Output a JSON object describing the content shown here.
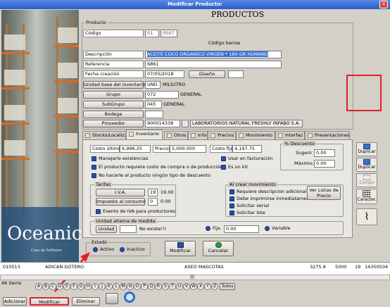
{
  "window": {
    "title": "Modificar Producto:",
    "heading": "PRODUCTOS",
    "close": "✕"
  },
  "product_group_label": "Producto",
  "fields": {
    "codigo_label": "Código",
    "codigo_prefix": "01",
    "codigo_value": "0507",
    "codigo_barras_label": "Código barras",
    "descripcion_label": "Descripción",
    "descripcion_value": "ACEITE COCO ORGANICO VIRGEN * 180 GR HUMANO",
    "referencia_label": "Referencia",
    "referencia_value": "6861",
    "fecha_label": "Fecha creación",
    "fecha_value": "07/05/2018",
    "diseno_button": "Diseño",
    "unidad_button": "Unidad base del inventario",
    "unidad_code": "UND",
    "unidad_name": "MILILITRO",
    "grupo_button": "Grupo",
    "grupo_code": "072",
    "grupo_name": "GENERAL",
    "subgrupo_button": "SubGrupo",
    "subgrupo_code": "045",
    "subgrupo_name": "GENERAL",
    "bodega_button": "Bodega",
    "proveedor_button": "Proveedor",
    "proveedor_code": "900014338",
    "proveedor_name": "LABORATORIOS NATURAL FRESHLY INFABO S.A."
  },
  "tabs": [
    {
      "label": "Stocks/Localiz."
    },
    {
      "label": "Inventario"
    },
    {
      "label": "Otros"
    },
    {
      "label": "Info"
    },
    {
      "label": "Precios"
    },
    {
      "label": "Movimiento"
    },
    {
      "label": "Interfaz"
    },
    {
      "label": "Presentaciones"
    }
  ],
  "inventario": {
    "costo_ultimo_label": "Costo último",
    "costo_ultimo_value": "6,996.25",
    "precio_label": "Precio",
    "precio_value": "5,000.000",
    "costo_fijo_label": "Costo fijo",
    "costo_fijo_value": "4,197.75",
    "descuento_title": "% Descuento",
    "sugerir_label": "Sugerir",
    "sugerir_value": "0.00",
    "maximo_label": "Máximo:",
    "maximo_value": "0.00",
    "manejarle_existencias": "Manejarle existencias",
    "usar_facturacion": "Usar en facturación",
    "requiere_costo": "El producto requiere costo de compra o de producción",
    "es_kit": "Es un kit",
    "no_hacerle_descuento": "No hacerle al producto ningún tipo de descuento",
    "tarifas_title": "Tarifas",
    "iva_button": "I.V.A.",
    "iva_code": "19",
    "iva_value": "19.00",
    "impuesto_button": "Impuesto al consumo",
    "impuesto_code": "0",
    "impuesto_value": "0.00",
    "exento_iva": "Exento de IVA para productores",
    "crear_mov_title": "Al crear movimiento",
    "requiere_descripcion": "Requiere descripcion adicional",
    "debe_imprimirse": "Debe imprimirse inmediatamente",
    "solicitar_serial": "Solicitar serial",
    "solicitar_lote": "Solicitar lote",
    "ver_listas_button": "Ver Listas de Precio",
    "unidad_alterna_title": "Unidad alterna de medida",
    "unidad_button": "Unidad",
    "no_existe": "No existe!!!",
    "fija_label": "Fija",
    "fija_value": "0.00",
    "variable_label": "Variable"
  },
  "side_buttons": {
    "duplicar1": "Duplicar",
    "duplicar2": "Duplicar",
    "compo": "Compo",
    "caracter": "Caracter."
  },
  "estado": {
    "title": "Estado",
    "activo": "Activo",
    "inactivo": "Inactivo"
  },
  "actions": {
    "modificar": "Modificar",
    "cancelar": "Cancelar"
  },
  "logo": {
    "name": "Oceanic",
    "tagline": "Casa de Software"
  },
  "list_row": {
    "code": "010513",
    "name": "ADICAN GOTERO",
    "category": "ASEO MASCOTAS",
    "v1": "3275.9",
    "v2": "5000",
    "v3": "19",
    "v4": "14350504"
  },
  "items_count": "46 items",
  "scroll_glyph": "|||",
  "letters": [
    "A",
    "B",
    "C",
    "D",
    "E",
    "F",
    "G",
    "H",
    "I",
    "J",
    "K",
    "L",
    "M",
    "N",
    "O",
    "P",
    "Q",
    "R",
    "S",
    "T",
    "U",
    "V",
    "W",
    "X",
    "Y",
    "Z"
  ],
  "todos_button": "Todos",
  "bottom_buttons": {
    "adicionar": "Adicionar",
    "modificar": "Modificar",
    "eliminar": "Eliminar"
  },
  "colors": {
    "title_bar": "#3b6fd6",
    "highlight_red": "#e0202a",
    "selection_blue": "#3c72d8",
    "checkbox_blue": "#2a4fa8"
  }
}
